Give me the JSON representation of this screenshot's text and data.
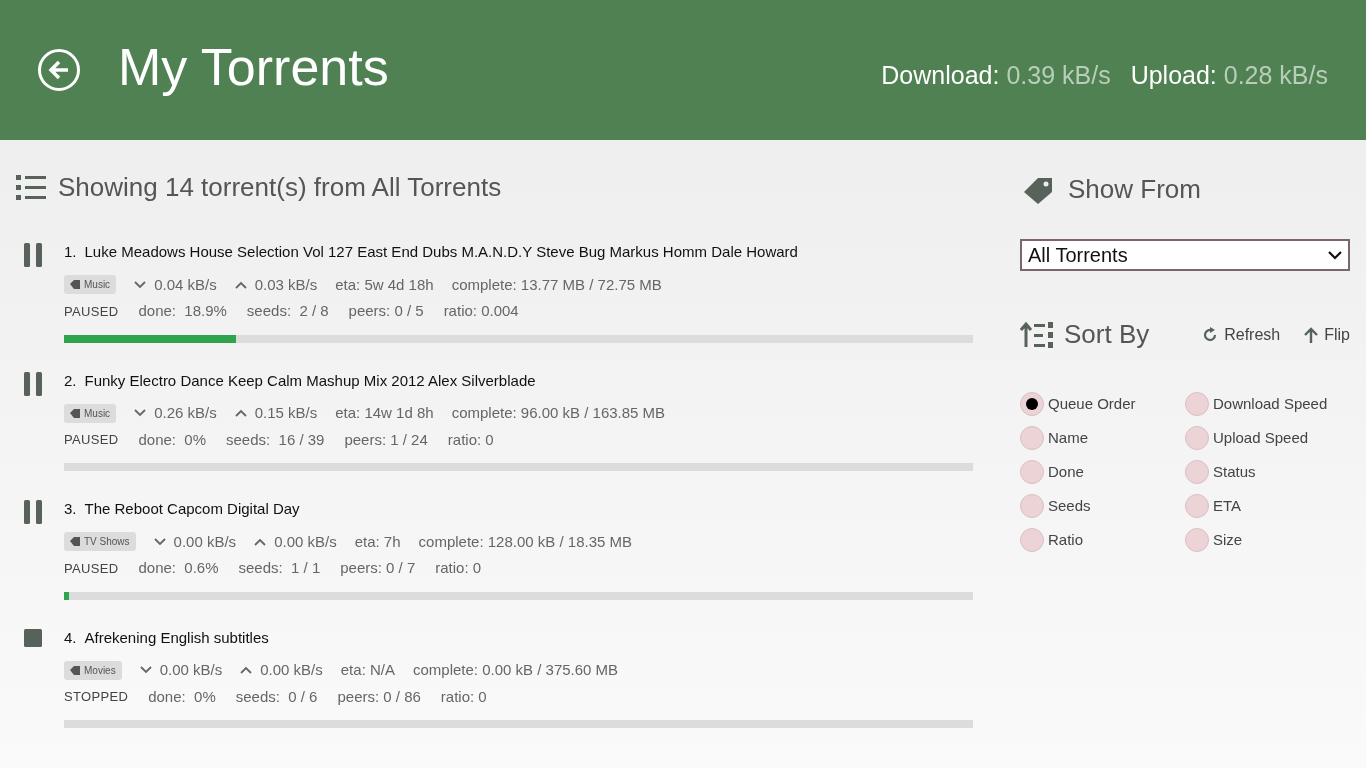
{
  "header": {
    "title": "My Torrents",
    "download_label": "Download:",
    "download_value": "0.39 kB/s",
    "upload_label": "Upload:",
    "upload_value": "0.28 kB/s"
  },
  "list_heading": "Showing 14 torrent(s) from All Torrents",
  "torrents": [
    {
      "kind": "paused",
      "number": "1.",
      "name": "Luke Meadows House Selection Vol 127 East End Dubs M.A.N.D.Y Steve Bug Markus Homm Dale Howard",
      "tag": "Music",
      "down": "0.04 kB/s",
      "up": "0.03 kB/s",
      "eta": "eta: 5w 4d 18h",
      "complete": "complete: 13.77 MB / 72.75 MB",
      "status": "PAUSED",
      "done": "done:  18.9%",
      "seeds": "seeds:  2 / 8",
      "peers": "peers: 0 / 5",
      "ratio": "ratio: 0.004",
      "level": 0.189
    },
    {
      "kind": "paused",
      "number": "2.",
      "name": "Funky Electro Dance Keep Calm Mashup Mix 2012 Alex Silverblade",
      "tag": "Music",
      "down": "0.26 kB/s",
      "up": "0.15 kB/s",
      "eta": "eta: 14w 1d 8h",
      "complete": "complete: 96.00 kB / 163.85 MB",
      "status": "PAUSED",
      "done": "done:  0%",
      "seeds": "seeds:  16 / 39",
      "peers": "peers: 1 / 24",
      "ratio": "ratio: 0"
    },
    {
      "kind": "paused",
      "number": "3.",
      "name": "The Reboot Capcom Digital Day",
      "tag": "TV Shows",
      "down": "0.00 kB/s",
      "up": "0.00 kB/s",
      "eta": "eta: 7h",
      "complete": "complete: 128.00 kB / 18.35 MB",
      "status": "PAUSED",
      "done": "done:  0.6%",
      "seeds": "seeds:  1 / 1",
      "peers": "peers: 0 / 7",
      "ratio": "ratio: 0",
      "level": 0.006
    },
    {
      "kind": "stopped",
      "number": "4.",
      "name": "Afrekening English subtitles",
      "tag": "Movies",
      "down": "0.00 kB/s",
      "up": "0.00 kB/s",
      "eta": "eta: N/A",
      "complete": "complete: 0.00 kB / 375.60 MB",
      "status": "STOPPED",
      "done": "done:  0%",
      "seeds": "seeds:  0 / 6",
      "peers": "peers: 0 / 86",
      "ratio": "ratio: 0"
    }
  ],
  "show_from": {
    "heading": "Show From",
    "selected_value": "All Torrents"
  },
  "sort_by": {
    "heading": "Sort By",
    "refresh": "Refresh",
    "flip": "Flip",
    "options": [
      {
        "label": "Queue Order",
        "selected": true
      },
      {
        "label": "Download Speed",
        "selected": false
      },
      {
        "label": "Name",
        "selected": false
      },
      {
        "label": "Upload Speed",
        "selected": false
      },
      {
        "label": "Done",
        "selected": false
      },
      {
        "label": "Status",
        "selected": false
      },
      {
        "label": "Seeds",
        "selected": false
      },
      {
        "label": "ETA",
        "selected": false
      },
      {
        "label": "Ratio",
        "selected": false
      },
      {
        "label": "Size",
        "selected": false
      }
    ]
  }
}
